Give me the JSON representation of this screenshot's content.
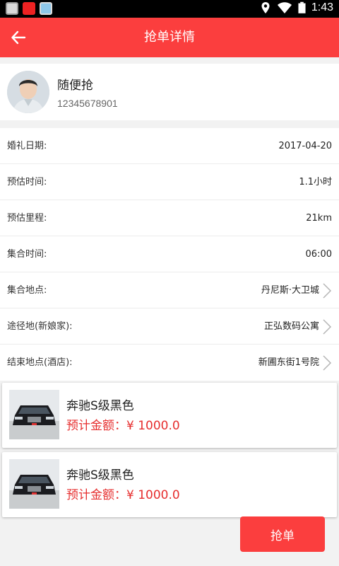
{
  "status_bar": {
    "time": "1:43",
    "left_icons": [
      "photo-notification-icon",
      "app-notification-icon",
      "keyboard-notification-icon"
    ],
    "right_icons": [
      "location-icon",
      "wifi-icon",
      "battery-icon"
    ]
  },
  "header": {
    "title": "抢单详情",
    "back_icon": "back-arrow-icon",
    "color": "#fb3e3e"
  },
  "user": {
    "name": "随便抢",
    "phone": "12345678901"
  },
  "info": [
    {
      "label": "婚礼日期:",
      "value": "2017-04-20"
    },
    {
      "label": "预估时间:",
      "value": "1.1小时"
    },
    {
      "label": "预估里程:",
      "value": "21km"
    },
    {
      "label": "集合时间:",
      "value": "06:00"
    },
    {
      "label": "集合地点:",
      "value": "丹尼斯·大卫城"
    },
    {
      "label": "途径地(新娘家):",
      "value": "正弘数码公寓"
    },
    {
      "label": "结束地点(酒店):",
      "value": "新圃东街1号院"
    }
  ],
  "cars": [
    {
      "name": "奔驰S级黑色",
      "price": "预计金额：¥ 1000.0"
    },
    {
      "name": "奔驰S级黑色",
      "price": "预计金额：¥ 1000.0"
    }
  ],
  "actions": {
    "grab_label": "抢单"
  },
  "colors": {
    "accent": "#fb3e3e",
    "price": "#e62e2e"
  }
}
